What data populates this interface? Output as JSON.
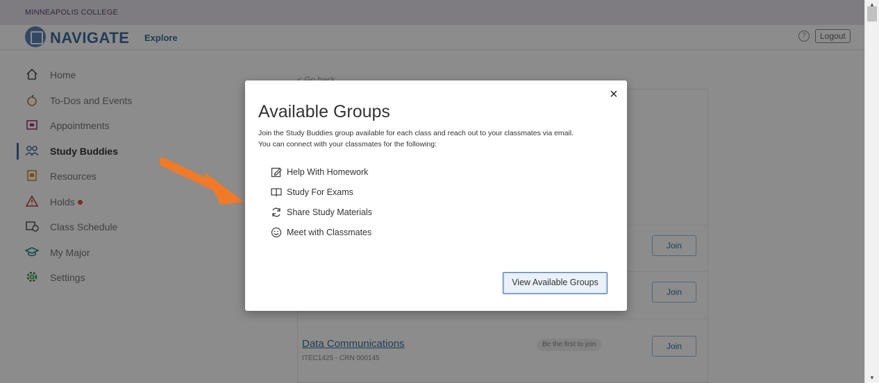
{
  "college": {
    "name": "MINNEAPOLIS COLLEGE"
  },
  "header": {
    "brand": "NAVIGATE",
    "explore_label": "Explore",
    "help_label": "?",
    "logout_label": "Logout"
  },
  "sidebar": {
    "items": [
      {
        "label": "Home",
        "icon": "home-icon"
      },
      {
        "label": "To-Dos and Events",
        "icon": "apple-icon"
      },
      {
        "label": "Appointments",
        "icon": "calendar-icon"
      },
      {
        "label": "Study Buddies",
        "icon": "people-icon",
        "active": true
      },
      {
        "label": "Resources",
        "icon": "resources-icon"
      },
      {
        "label": "Holds",
        "icon": "warning-icon",
        "badge": true
      },
      {
        "label": "Class Schedule",
        "icon": "schedule-icon"
      },
      {
        "label": "My Major",
        "icon": "graduation-cap-icon"
      },
      {
        "label": "Settings",
        "icon": "gear-icon"
      }
    ]
  },
  "main": {
    "go_back": "< Go back",
    "join_label": "Join",
    "course": {
      "title": "Data Communications",
      "meta": "ITEC1425 - CRN 000145",
      "badge": "Be the first to join"
    }
  },
  "modal": {
    "title": "Available Groups",
    "description_line1": "Join the Study Buddies group available for each class and reach out to your classmates via email.",
    "description_line2": "You can connect with your classmates for the following:",
    "features": [
      {
        "label": "Help With Homework",
        "icon": "edit-icon"
      },
      {
        "label": "Study For Exams",
        "icon": "book-icon"
      },
      {
        "label": "Share Study Materials",
        "icon": "refresh-icon"
      },
      {
        "label": "Meet with Classmates",
        "icon": "smiley-icon"
      }
    ],
    "close_label": "×",
    "button_label": "View Available Groups"
  },
  "colors": {
    "brand_blue": "#3e6c9e",
    "arrow_orange": "#f07a28",
    "college_bar": "#e8e2ec"
  }
}
